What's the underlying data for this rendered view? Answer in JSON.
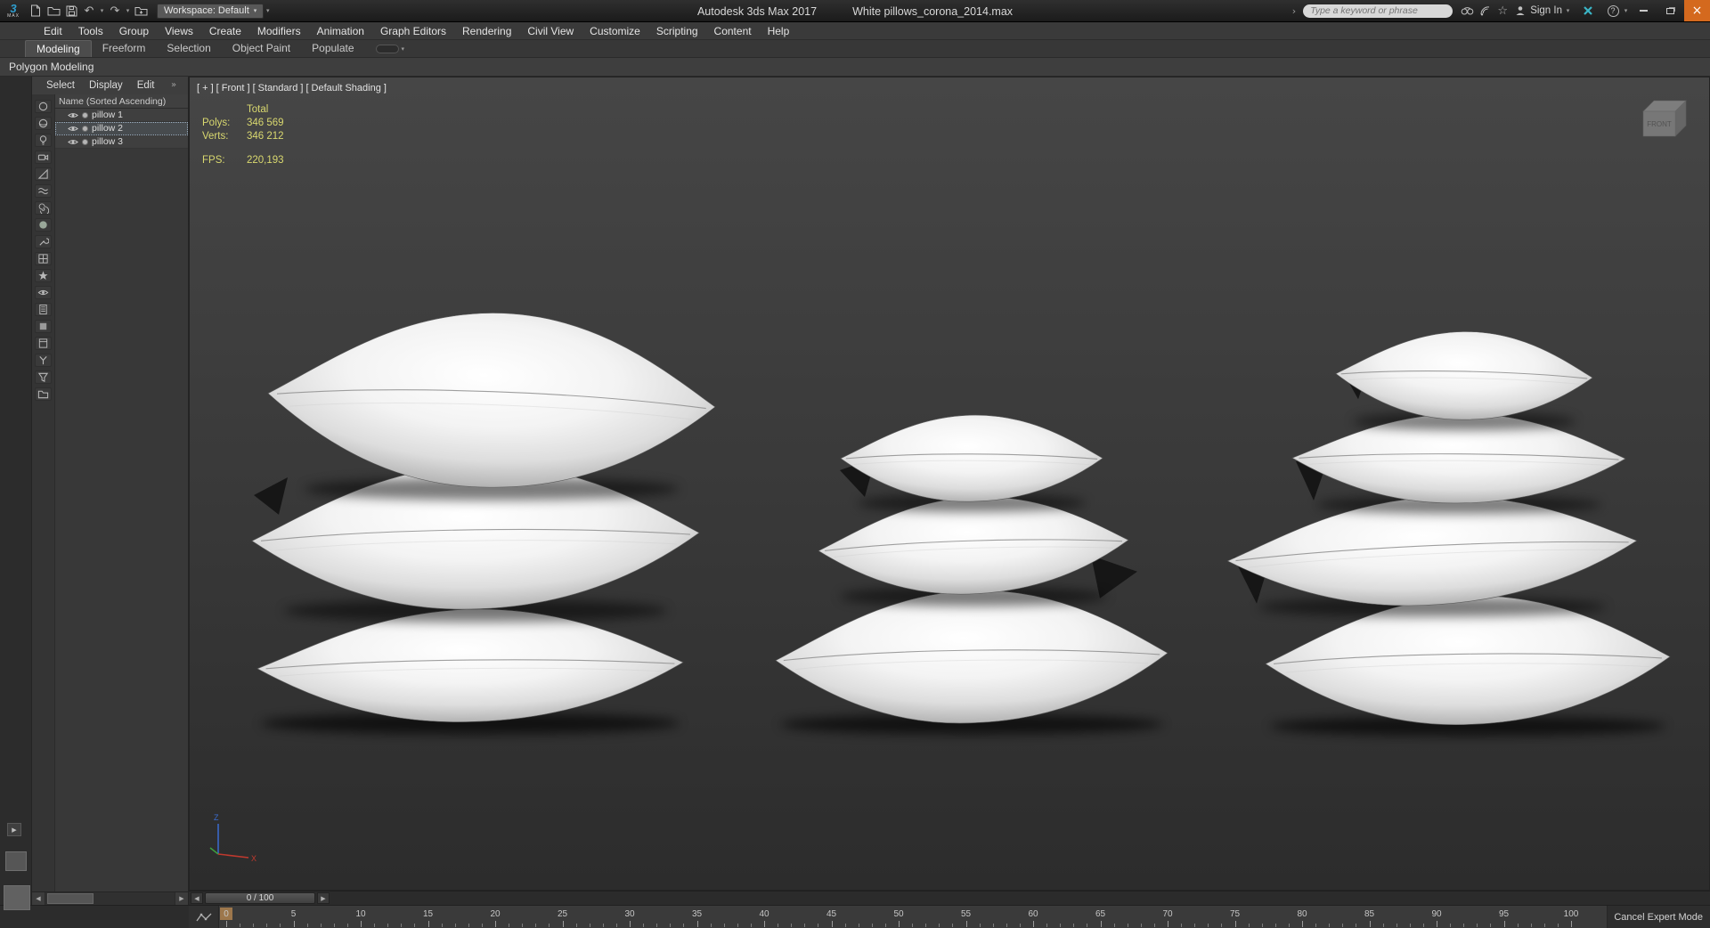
{
  "colors": {
    "stats_text": "#d9d86f",
    "close_button": "#d4691e",
    "selection_outline": "#9fb2c4",
    "frame_marker": "#a97e4f",
    "viewport_background": "#3a3a3a"
  },
  "title_bar": {
    "workspace": "Workspace: Default",
    "app_title": "Autodesk 3ds Max 2017",
    "document_title": "White pillows_corona_2014.max",
    "search_placeholder": "Type a keyword or phrase",
    "sign_in": "Sign In"
  },
  "menu_bar": [
    "Edit",
    "Tools",
    "Group",
    "Views",
    "Create",
    "Modifiers",
    "Animation",
    "Graph Editors",
    "Rendering",
    "Civil View",
    "Customize",
    "Scripting",
    "Content",
    "Help"
  ],
  "ribbon": {
    "tabs": [
      "Modeling",
      "Freeform",
      "Selection",
      "Object Paint",
      "Populate"
    ],
    "active_tab": "Modeling",
    "panel_title": "Polygon Modeling"
  },
  "scene_explorer": {
    "menus": [
      "Select",
      "Display",
      "Edit"
    ],
    "overflow": "»",
    "header": "Name (Sorted Ascending)",
    "items": [
      {
        "name": "pillow 1",
        "selected": false
      },
      {
        "name": "pillow 2",
        "selected": true
      },
      {
        "name": "pillow 3",
        "selected": false
      }
    ]
  },
  "viewport": {
    "label_segments": [
      "[ + ]",
      "[ Front ]",
      "[ Standard ]",
      "[ Default Shading ]"
    ],
    "stats": {
      "total": "Total",
      "polys_label": "Polys:",
      "polys": "346 569",
      "verts_label": "Verts:",
      "verts": "346 212",
      "fps_label": "FPS:",
      "fps": "220,193"
    },
    "viewcube": "FRONT",
    "axis": {
      "x": "X",
      "z": "Z"
    }
  },
  "timeline": {
    "slider": "0 / 100",
    "tick_labels": [
      "0",
      "5",
      "10",
      "15",
      "20",
      "25",
      "30",
      "35",
      "40",
      "45",
      "50",
      "55",
      "60",
      "65",
      "70",
      "75",
      "80",
      "85",
      "90",
      "95",
      "100"
    ]
  },
  "status_bar": {
    "expert_mode": "Cancel Expert Mode"
  },
  "icons": {
    "undo": "↶",
    "redo": "↷",
    "caret_down": "▾",
    "search_chevron": "›",
    "star": "☆",
    "close": "×",
    "scroll_left": "◀",
    "scroll_right": "▶",
    "prev_frame": "◀",
    "next_frame": "▶",
    "expand_right": "▶"
  }
}
